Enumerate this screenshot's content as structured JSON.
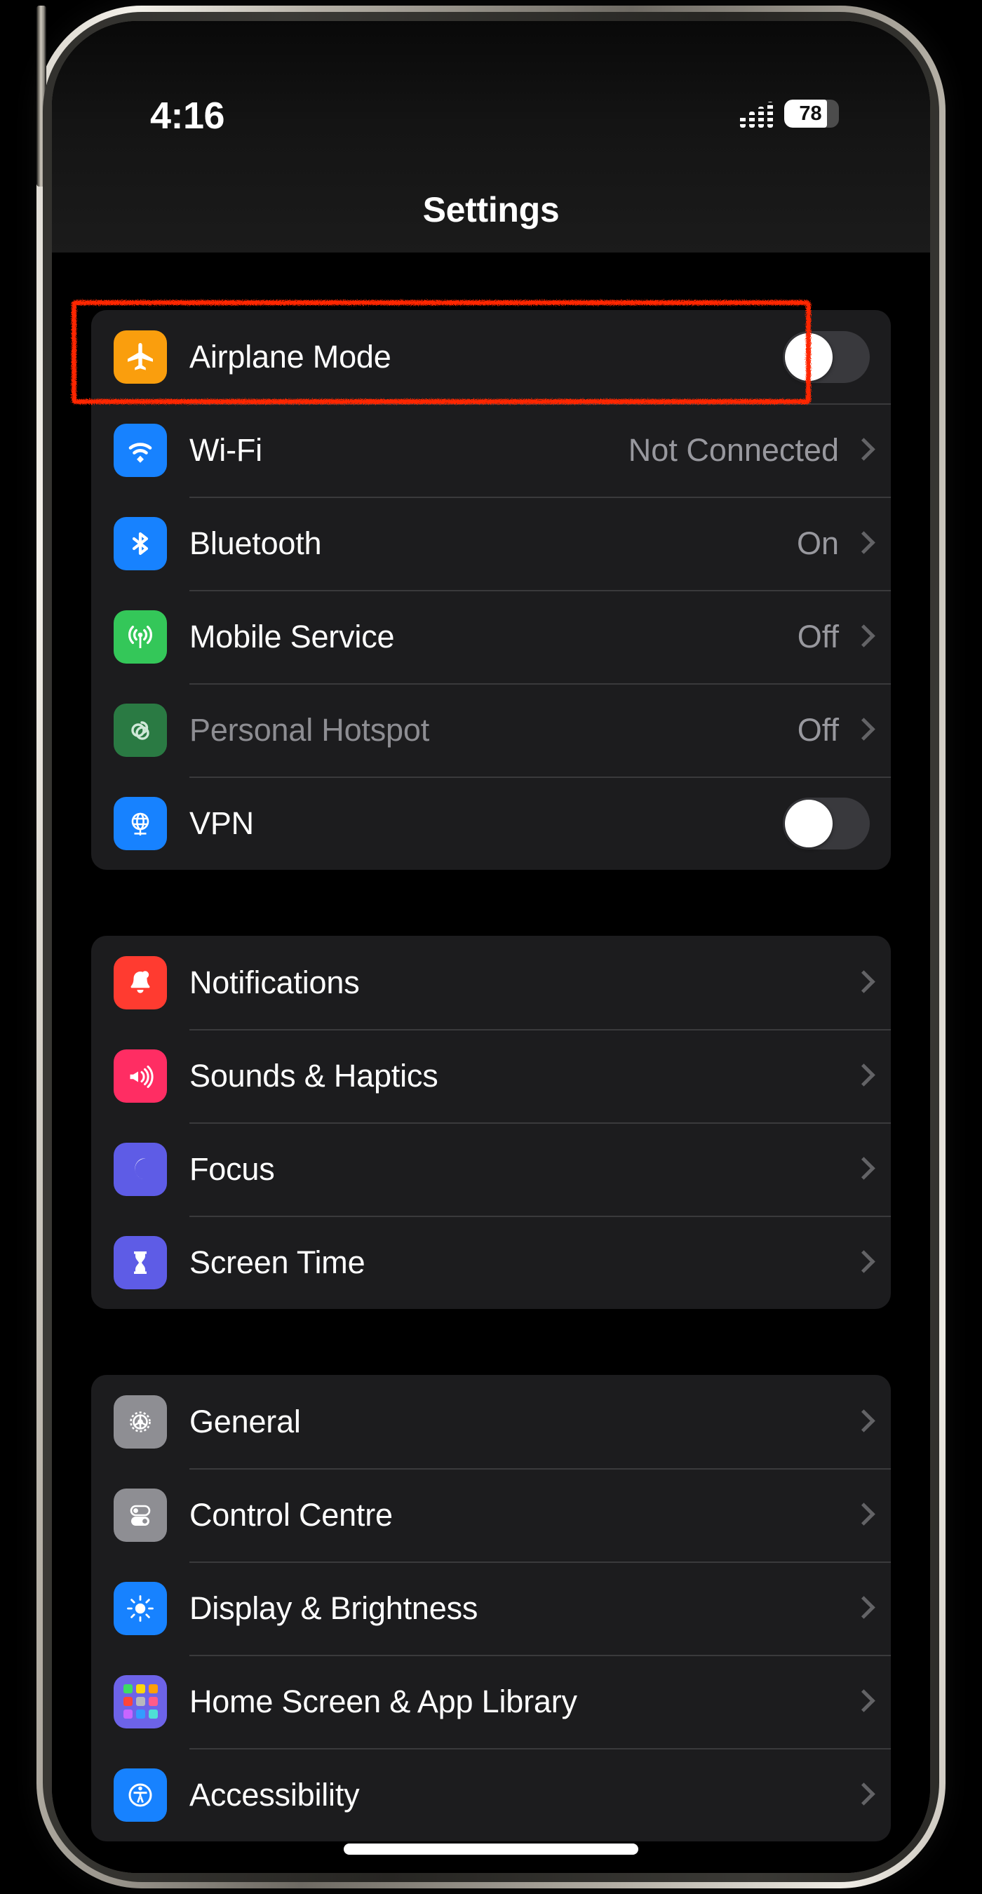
{
  "device": {
    "frame": "iphone",
    "bezel_color": "#cac5bc",
    "screen_background": "#000000"
  },
  "status_bar": {
    "time": "4:16",
    "signal_icon": "cellular-bars-icon",
    "battery_percent": "78",
    "battery_level": 78,
    "battery_icon": "battery-icon"
  },
  "header": {
    "title": "Settings"
  },
  "annotation": {
    "target": "Airplane Mode",
    "color": "#ff2600"
  },
  "groups": [
    {
      "id": "connectivity",
      "rows": [
        {
          "label": "Airplane Mode",
          "icon": "airplane-icon",
          "icon_class": "ic-airplane",
          "control": "toggle",
          "toggle_on": false,
          "highlighted": true,
          "disabled": false
        },
        {
          "label": "Wi-Fi",
          "icon": "wifi-icon",
          "icon_class": "ic-wifi",
          "control": "chevron",
          "value": "Not Connected",
          "disabled": false
        },
        {
          "label": "Bluetooth",
          "icon": "bluetooth-icon",
          "icon_class": "ic-bluetooth",
          "control": "chevron",
          "value": "On",
          "disabled": false
        },
        {
          "label": "Mobile Service",
          "icon": "cellular-icon",
          "icon_class": "ic-cellular",
          "control": "chevron",
          "value": "Off",
          "disabled": false
        },
        {
          "label": "Personal Hotspot",
          "icon": "hotspot-link-icon",
          "icon_class": "ic-hotspot",
          "control": "chevron",
          "value": "Off",
          "disabled": true
        },
        {
          "label": "VPN",
          "icon": "vpn-globe-icon",
          "icon_class": "ic-vpn",
          "control": "toggle",
          "toggle_on": false,
          "disabled": false
        }
      ]
    },
    {
      "id": "alerts",
      "rows": [
        {
          "label": "Notifications",
          "icon": "bell-icon",
          "icon_class": "ic-notif",
          "control": "chevron",
          "value": "",
          "disabled": false
        },
        {
          "label": "Sounds & Haptics",
          "icon": "speaker-icon",
          "icon_class": "ic-sounds",
          "control": "chevron",
          "value": "",
          "disabled": false
        },
        {
          "label": "Focus",
          "icon": "moon-icon",
          "icon_class": "ic-focus",
          "control": "chevron",
          "value": "",
          "disabled": false
        },
        {
          "label": "Screen Time",
          "icon": "hourglass-icon",
          "icon_class": "ic-screentime",
          "control": "chevron",
          "value": "",
          "disabled": false
        }
      ]
    },
    {
      "id": "system",
      "rows": [
        {
          "label": "General",
          "icon": "gear-icon",
          "icon_class": "ic-general",
          "control": "chevron",
          "value": "",
          "disabled": false
        },
        {
          "label": "Control Centre",
          "icon": "toggles-icon",
          "icon_class": "ic-control",
          "control": "chevron",
          "value": "",
          "disabled": false
        },
        {
          "label": "Display & Brightness",
          "icon": "brightness-sun-icon",
          "icon_class": "ic-display",
          "control": "chevron",
          "value": "",
          "disabled": false
        },
        {
          "label": "Home Screen & App Library",
          "icon": "app-grid-icon",
          "icon_class": "ic-homescreen",
          "control": "chevron",
          "value": "",
          "disabled": false
        },
        {
          "label": "Accessibility",
          "icon": "accessibility-icon",
          "icon_class": "ic-access",
          "control": "chevron",
          "value": "",
          "disabled": false
        }
      ]
    }
  ]
}
